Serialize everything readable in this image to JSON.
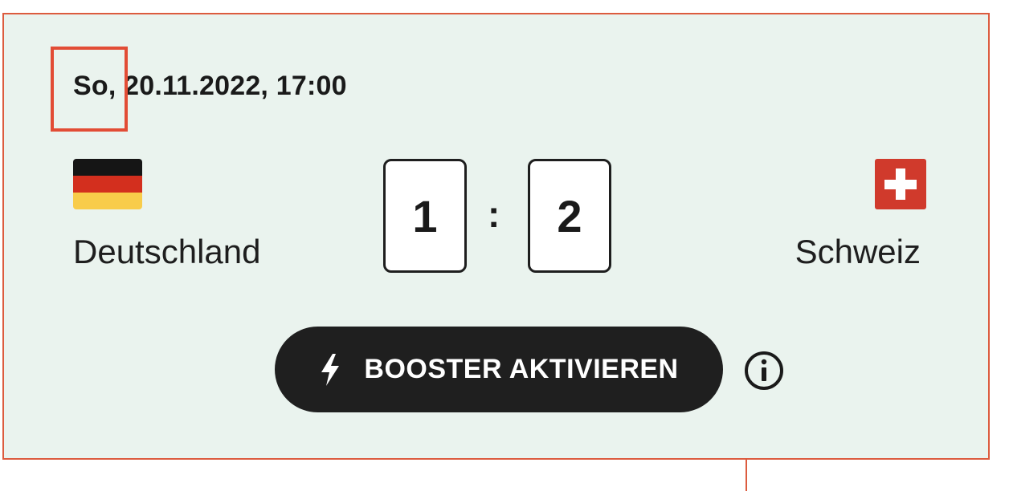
{
  "match": {
    "date": "So, 20.11.2022, 17:00",
    "home": {
      "name": "Deutschland",
      "flag": "germany-flag-icon",
      "score": "1"
    },
    "away": {
      "name": "Schweiz",
      "flag": "switzerland-flag-icon",
      "score": "2"
    },
    "separator": ":"
  },
  "booster": {
    "label": "BOOSTER AKTIVIEREN",
    "icon": "lightning-bolt-icon"
  },
  "info_icon": "info-circle-icon",
  "colors": {
    "card_background": "#eaf3ee",
    "card_border": "#dc5b3e",
    "highlight_box": "#e24c35",
    "button_background": "#1f1f1f",
    "button_text": "#ffffff",
    "de_black": "#151515",
    "de_red": "#d32f1e",
    "de_gold": "#f8cc4a",
    "ch_red": "#d03a2c"
  }
}
